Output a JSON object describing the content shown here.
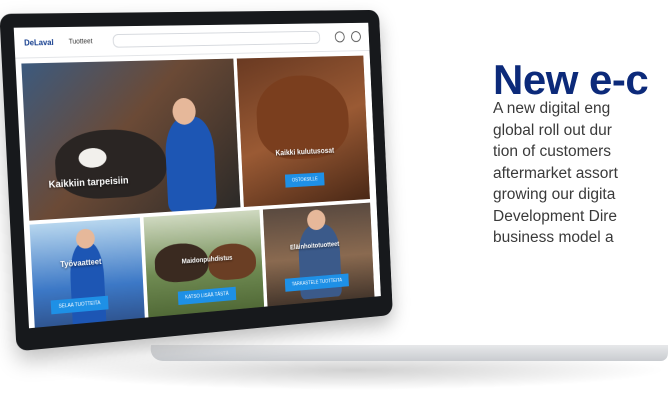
{
  "header": {
    "logo": "DeLaval",
    "nav": "Tuotteet"
  },
  "tiles": {
    "t1": {
      "title": "Kaikkiin tarpeisiin"
    },
    "t2": {
      "title": "Kaikki kulutusosat",
      "button": "OSTOKSILLE"
    },
    "t3": {
      "title": "Työvaatteet",
      "button": "SELAA TUOTTEITA"
    },
    "t4": {
      "title": "Maidonpuhdistus",
      "button": "KATSO LISÄÄ TÄSTÄ"
    },
    "t5": {
      "title": "Eläinhoitotuotteet",
      "button": "TARKASTELE TUOTTEITA"
    }
  },
  "article": {
    "headline": "New e-c",
    "lines": [
      "A new digital eng",
      "global roll out dur",
      "tion of customers",
      "aftermarket assort",
      "growing our digita",
      "Development Dire",
      "business model a"
    ]
  }
}
